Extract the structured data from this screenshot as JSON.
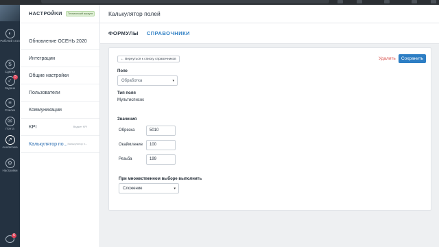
{
  "rail": {
    "items": [
      {
        "label": "Рабочий стол",
        "icon": "dashboard-icon"
      },
      {
        "label": "Сделки",
        "icon": "deals-icon"
      },
      {
        "label": "Задачи",
        "icon": "tasks-icon",
        "badge": "5"
      },
      {
        "label": "Списки",
        "icon": "lists-icon"
      },
      {
        "label": "Почта",
        "icon": "mail-icon"
      },
      {
        "label": "Аналитика",
        "icon": "analytics-icon"
      },
      {
        "label": "Настройки",
        "icon": "settings-icon"
      }
    ],
    "bottom_badge": "6"
  },
  "sidebar": {
    "title": "НАСТРОЙКИ",
    "tag": "Технический аккаунт",
    "items": [
      {
        "label": "Обновление ОСЕНЬ 2020",
        "sub": ""
      },
      {
        "label": "Интеграции",
        "sub": ""
      },
      {
        "label": "Общие настройки",
        "sub": ""
      },
      {
        "label": "Пользователи",
        "sub": ""
      },
      {
        "label": "Коммуникации",
        "sub": ""
      },
      {
        "label": "KPI",
        "sub": "Виджет KPI"
      },
      {
        "label": "Калькулятор по...",
        "sub": "Калькулятор п..."
      }
    ]
  },
  "main": {
    "title": "Калькулятор полей",
    "tabs": [
      "ФОРМУЛЫ",
      "СПРАВОЧНИКИ"
    ]
  },
  "form": {
    "back_label": "← Вернуться к списку справочников",
    "delete_label": "Удалить",
    "save_label": "Сохранить",
    "field_label": "Поле",
    "field_value": "Обработка",
    "type_label": "Тип поля",
    "type_value": "Мультисписок",
    "values_label": "Значения",
    "values": [
      {
        "name": "Обрезка",
        "value": "5010"
      },
      {
        "name": "Окаймление",
        "value": "100"
      },
      {
        "name": "Резьба",
        "value": "199"
      }
    ],
    "multi_label": "При множественном выборе выполнить",
    "multi_value": "Сложение"
  }
}
